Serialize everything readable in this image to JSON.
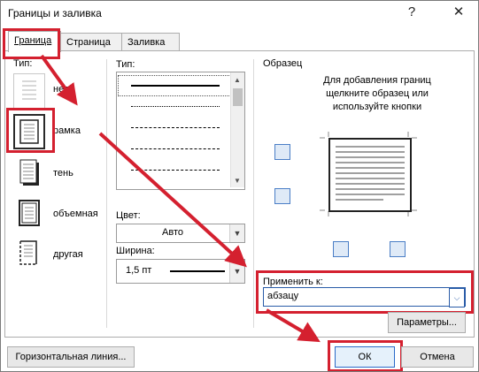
{
  "window": {
    "title": "Границы и заливка",
    "help": "?",
    "close": "✕"
  },
  "tabs": [
    {
      "label": "Граница",
      "active": true
    },
    {
      "label": "Страница",
      "active": false
    },
    {
      "label": "Заливка",
      "active": false
    }
  ],
  "type_section": {
    "heading": "Тип:",
    "options": [
      {
        "label": "нет",
        "selected": false
      },
      {
        "label": "рамка",
        "selected": true
      },
      {
        "label": "тень",
        "selected": false
      },
      {
        "label": "объемная",
        "selected": false
      },
      {
        "label": "другая",
        "selected": false
      }
    ]
  },
  "style_section": {
    "heading": "Тип:",
    "color_label": "Цвет:",
    "color_value": "Авто",
    "width_label": "Ширина:",
    "width_value": "1,5 пт"
  },
  "preview_section": {
    "heading": "Образец",
    "hint": "Для добавления границ щелкните образец или используйте кнопки",
    "apply_label": "Применить к:",
    "apply_value": "абзацу",
    "options_button": "Параметры..."
  },
  "footer": {
    "horizontal_line_button": "Горизонтальная линия...",
    "ok_button": "ОК",
    "cancel_button": "Отмена"
  },
  "colors": {
    "highlight": "#d4202f"
  }
}
